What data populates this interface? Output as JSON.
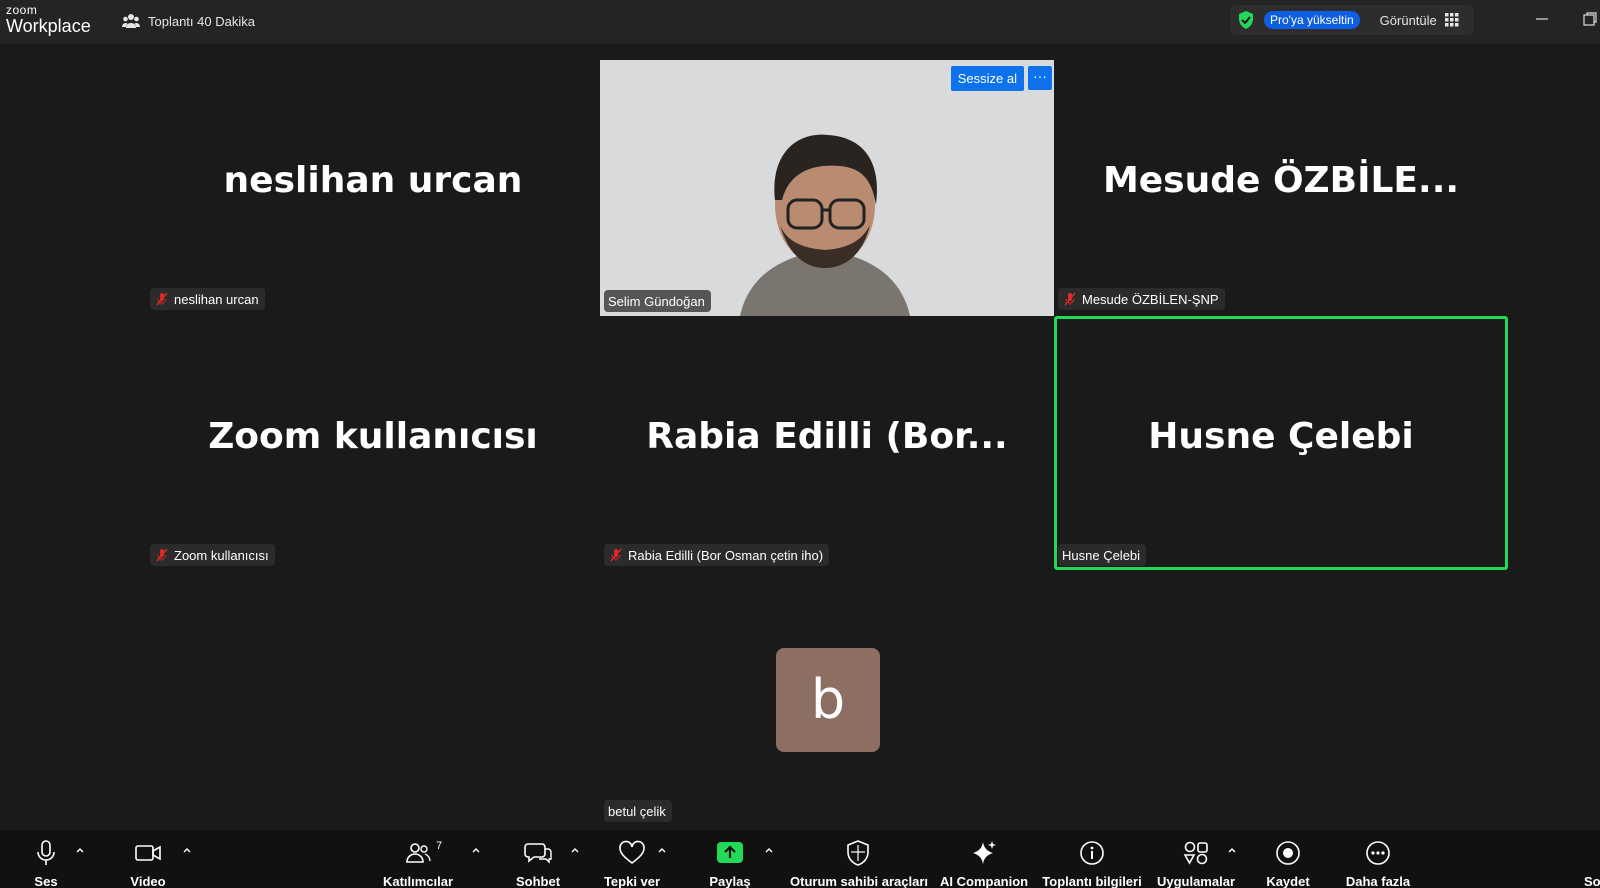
{
  "app": {
    "logo_top": "zoom",
    "logo_bottom": "Workplace",
    "meeting_title": "Toplantı 40 Dakika",
    "pro_button": "Pro'ya yükseltin",
    "view_label": "Görüntüle"
  },
  "colors": {
    "accent_blue": "#0e72ed",
    "active_speaker": "#23d959",
    "background": "#1a1a1a",
    "avatar_bg": "#8d6e63"
  },
  "participants": [
    {
      "display": "neslihan urcan",
      "name": "neslihan urcan",
      "muted": true
    },
    {
      "display": "",
      "name": "Selim Gündoğan",
      "muted": false,
      "video": true
    },
    {
      "display": "Mesude  ÖZBİLE...",
      "name": "Mesude ÖZBİLEN-ŞNP",
      "muted": true
    },
    {
      "display": "Zoom kullanıcısı",
      "name": "Zoom kullanıcısı",
      "muted": true
    },
    {
      "display": "Rabia  Edilli  (Bor...",
      "name": "Rabia Edilli (Bor Osman çetin iho)",
      "muted": true
    },
    {
      "display": "Husne Çelebi",
      "name": "Husne Çelebi",
      "muted": false,
      "active": true
    },
    {
      "display": "b",
      "name": "betul çelik",
      "muted": false
    }
  ],
  "video_controls": {
    "unmute": "Sessize al",
    "more": "···"
  },
  "toolbar": {
    "audio": "Ses",
    "video": "Video",
    "participants": "Katılımcılar",
    "participants_count": "7",
    "chat": "Sohbet",
    "react": "Tepki ver",
    "share": "Paylaş",
    "host_tools": "Oturum sahibi araçları",
    "ai": "AI Companion",
    "info": "Toplantı bilgileri",
    "apps": "Uygulamalar",
    "record": "Kaydet",
    "more": "Daha fazla",
    "end_partial": "So"
  }
}
